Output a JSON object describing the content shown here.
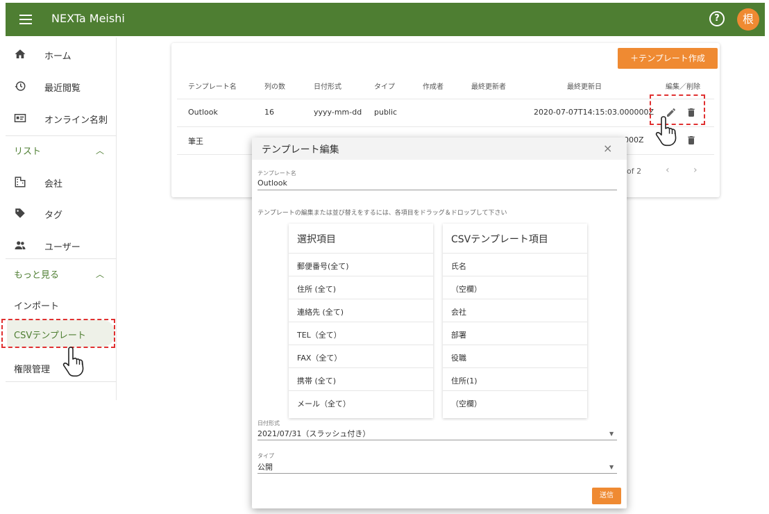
{
  "app": {
    "title": "NEXTa Meishi",
    "help_glyph": "?",
    "avatar_text": "根"
  },
  "sidebar": {
    "items": [
      {
        "label": "ホーム",
        "icon": "home-icon"
      },
      {
        "label": "最近閲覧",
        "icon": "history-icon"
      },
      {
        "label": "オンライン名刺",
        "icon": "card-icon"
      }
    ],
    "list_section": "リスト",
    "list_items": [
      {
        "label": "会社",
        "icon": "building-icon"
      },
      {
        "label": "タグ",
        "icon": "tag-icon"
      },
      {
        "label": "ユーザー",
        "icon": "people-icon"
      }
    ],
    "more_section": "もっと見る",
    "more_items": [
      {
        "label": "インポート"
      },
      {
        "label": "CSVテンプレート"
      },
      {
        "label": "権限管理"
      }
    ],
    "chevron": "︿"
  },
  "template_list": {
    "create_button": "＋テンプレート作成",
    "columns": [
      "テンプレート名",
      "列の数",
      "日付形式",
      "タイプ",
      "作成者",
      "最終更新者",
      "最終更新日",
      "編集／削除"
    ],
    "rows": [
      {
        "name": "Outlook",
        "count": "16",
        "date_format": "yyyy-mm-dd",
        "type": "public",
        "creator": "",
        "updater": "",
        "updated": "2020-07-07T14:15:03.000000Z"
      },
      {
        "name": "筆王",
        "updated_tail": "000Z"
      }
    ],
    "pagination": "of 2",
    "prev": "‹",
    "next": "›"
  },
  "dialog": {
    "title": "テンプレート編集",
    "close": "×",
    "name_label": "テンプレート名",
    "name_value": "Outlook",
    "hint": "テンプレートの編集または並び替えをするには、各項目をドラッグ＆ドロップして下さい",
    "available": {
      "header": "選択項目",
      "items": [
        "郵便番号(全て)",
        "住所 (全て)",
        "連絡先 (全て)",
        "TEL（全て）",
        "FAX（全て）",
        "携帯 (全て)",
        "メール（全て）"
      ]
    },
    "csv": {
      "header": "CSVテンプレート項目",
      "items": [
        "氏名",
        "（空欄）",
        "会社",
        "部署",
        "役職",
        "住所(1)",
        "（空欄）"
      ]
    },
    "date_label": "日付形式",
    "date_value": "2021/07/31（スラッシュ付き）",
    "type_label": "タイプ",
    "type_value": "公開",
    "dropdown_arrow": "▼",
    "submit": "送信"
  },
  "colors": {
    "primary": "#4e7e32",
    "accent": "#ef8a32",
    "highlight": "#e03030"
  }
}
